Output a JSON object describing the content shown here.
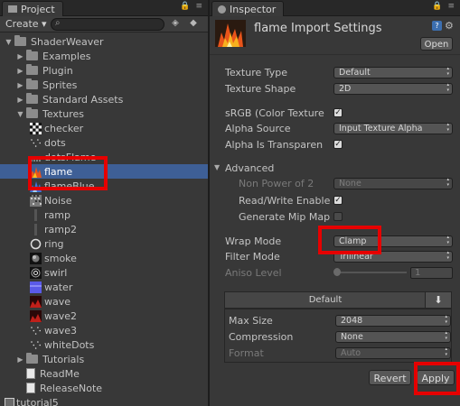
{
  "project": {
    "tab_label": "Project",
    "create_label": "Create ▾",
    "items": [
      {
        "label": "ShaderWeaver",
        "kind": "folder",
        "arrow": "▼"
      },
      {
        "label": "Examples",
        "kind": "folder",
        "arrow": "▶"
      },
      {
        "label": "Plugin",
        "kind": "folder",
        "arrow": "▶"
      },
      {
        "label": "Sprites",
        "kind": "folder",
        "arrow": "▶"
      },
      {
        "label": "Standard Assets",
        "kind": "folder",
        "arrow": "▶"
      },
      {
        "label": "Textures",
        "kind": "folder",
        "arrow": "▼"
      },
      {
        "label": "checker",
        "kind": "tex"
      },
      {
        "label": "dots",
        "kind": "tex"
      },
      {
        "label": "dotsFlame",
        "kind": "tex"
      },
      {
        "label": "flame",
        "kind": "tex",
        "selected": true
      },
      {
        "label": "flameBlue",
        "kind": "tex"
      },
      {
        "label": "Noise",
        "kind": "tex"
      },
      {
        "label": "ramp",
        "kind": "tex"
      },
      {
        "label": "ramp2",
        "kind": "tex"
      },
      {
        "label": "ring",
        "kind": "tex"
      },
      {
        "label": "smoke",
        "kind": "tex"
      },
      {
        "label": "swirl",
        "kind": "tex"
      },
      {
        "label": "water",
        "kind": "tex"
      },
      {
        "label": "wave",
        "kind": "tex"
      },
      {
        "label": "wave2",
        "kind": "tex"
      },
      {
        "label": "wave3",
        "kind": "tex"
      },
      {
        "label": "whiteDots",
        "kind": "tex"
      },
      {
        "label": "Tutorials",
        "kind": "folder",
        "arrow": "▶"
      },
      {
        "label": "ReadMe",
        "kind": "doc"
      },
      {
        "label": "ReleaseNote",
        "kind": "doc"
      },
      {
        "label": "tutorial5",
        "kind": "scene"
      }
    ]
  },
  "inspector": {
    "tab_label": "Inspector",
    "title": "flame Import Settings",
    "open_label": "Open",
    "texture_type": {
      "label": "Texture Type",
      "value": "Default"
    },
    "texture_shape": {
      "label": "Texture Shape",
      "value": "2D"
    },
    "srgb_label": "sRGB (Color Texture",
    "alpha_source": {
      "label": "Alpha Source",
      "value": "Input Texture Alpha"
    },
    "alpha_transparency_label": "Alpha Is Transparen",
    "advanced_label": "Advanced",
    "non_power_of_2": {
      "label": "Non Power of 2",
      "value": "None"
    },
    "read_write_label": "Read/Write Enable",
    "generate_mip_label": "Generate Mip Map",
    "wrap_mode": {
      "label": "Wrap Mode",
      "value": "Clamp"
    },
    "filter_mode": {
      "label": "Filter Mode",
      "value": "Trilinear"
    },
    "aniso_level": {
      "label": "Aniso Level",
      "value": "1"
    },
    "platform_tab": "Default",
    "max_size": {
      "label": "Max Size",
      "value": "2048"
    },
    "compression": {
      "label": "Compression",
      "value": "None"
    },
    "format": {
      "label": "Format",
      "value": "Auto"
    },
    "revert_label": "Revert",
    "apply_label": "Apply"
  },
  "colors": {
    "selection": "#3e5f96",
    "highlight_box": "#e60000",
    "background": "#383838"
  }
}
